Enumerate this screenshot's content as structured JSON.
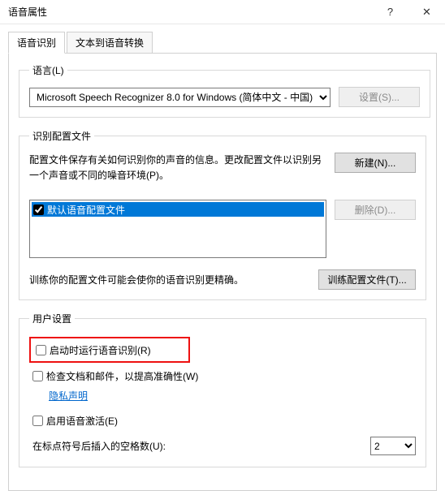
{
  "window": {
    "title": "语音属性",
    "help": "?",
    "close": "✕"
  },
  "tabs": {
    "speech_recognition": "语音识别",
    "tts": "文本到语音转换"
  },
  "language_group": {
    "legend": "语言(L)",
    "selected": "Microsoft Speech Recognizer 8.0 for Windows (简体中文 - 中国)",
    "settings_btn": "设置(S)..."
  },
  "profiles_group": {
    "legend": "识别配置文件",
    "desc": "配置文件保存有关如何识别你的声音的信息。更改配置文件以识别另一个声音或不同的噪音环境(P)。",
    "new_btn": "新建(N)...",
    "delete_btn": "删除(D)...",
    "default_profile": "默认语音配置文件",
    "train_desc": "训练你的配置文件可能会使你的语音识别更精确。",
    "train_btn": "训练配置文件(T)..."
  },
  "user_group": {
    "legend": "用户设置",
    "run_at_startup": "启动时运行语音识别(R)",
    "review_docs": "检查文档和邮件，以提高准确性(W)",
    "privacy_link": "隐私声明",
    "enable_voice_activation": "启用语音激活(E)",
    "spaces_label": "在标点符号后插入的空格数(U):",
    "spaces_value": "2"
  }
}
